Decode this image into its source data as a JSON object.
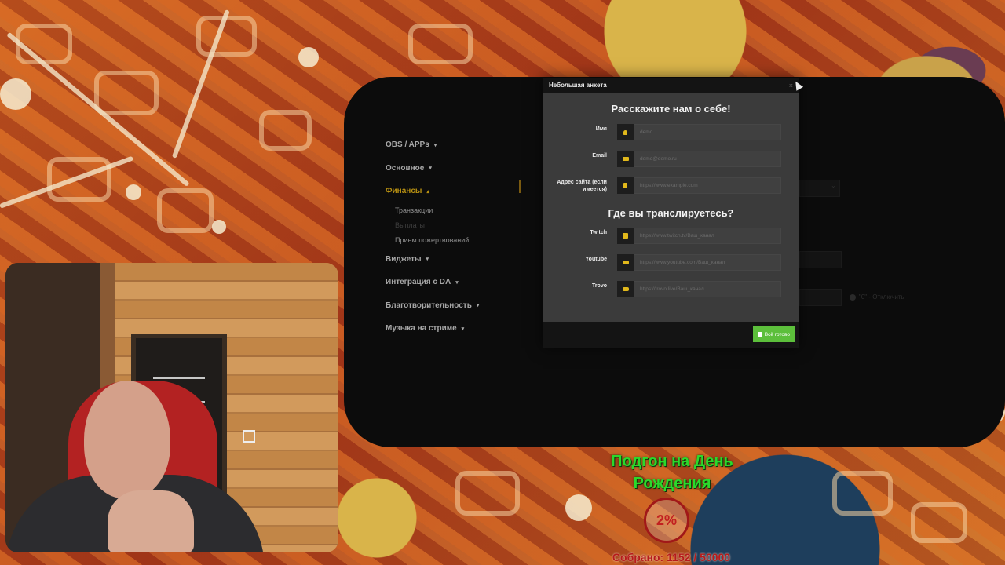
{
  "sidebar": {
    "items": [
      {
        "label": "OBS / APPs",
        "caret": "▾",
        "active": false
      },
      {
        "label": "Основное",
        "caret": "▾",
        "active": false
      },
      {
        "label": "Финансы",
        "caret": "▴",
        "active": true
      },
      {
        "label": "Виджеты",
        "caret": "▾",
        "active": false
      },
      {
        "label": "Интеграция с DA",
        "caret": "▾",
        "active": false
      },
      {
        "label": "Благотворительность",
        "caret": "▾",
        "active": false
      },
      {
        "label": "Музыка на стриме",
        "caret": "▾",
        "active": false
      }
    ],
    "finance_sub": [
      "Транзакции",
      "Выплаты",
      "Прием пожертвований"
    ]
  },
  "background_hint": {
    "info_text": "\"0\" - Отключить"
  },
  "modal": {
    "title": "Небольшая анкета",
    "close_glyph": "×",
    "about_heading": "Расскажите нам о себе!",
    "about_fields": [
      {
        "label": "Имя",
        "placeholder": "demo",
        "icon": "user-icon"
      },
      {
        "label": "Email",
        "placeholder": "demo@demo.ru",
        "icon": "envelope-icon"
      },
      {
        "label": "Адрес сайта (если имеется)",
        "placeholder": "https://www.example.com",
        "icon": "bookmark-icon"
      }
    ],
    "stream_heading": "Где вы транслируетесь?",
    "stream_fields": [
      {
        "label": "Twitch",
        "placeholder": "https://www.twitch.tv/Ваш_канал",
        "icon": "twitch-icon"
      },
      {
        "label": "Youtube",
        "placeholder": "https://www.youtube.com/Ваш_канал",
        "icon": "youtube-icon"
      },
      {
        "label": "Trovo",
        "placeholder": "https://trovo.live/Ваш_канал",
        "icon": "trovo-icon"
      }
    ],
    "done_label": "Всё готово",
    "done_color": "#5cbf3b",
    "accent_color": "#e1b81b"
  },
  "goal": {
    "title": "Подгон на День Рождения",
    "percent_text": "2%",
    "percent": 2,
    "collected_text": "Собрано: 1152 / 50000",
    "collected": 1152,
    "target": 50000,
    "title_color": "#2bd92b",
    "progress_color": "#c22020"
  }
}
